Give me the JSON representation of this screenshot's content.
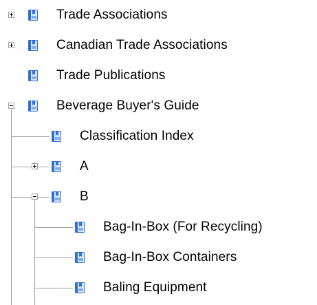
{
  "tree": {
    "nodes": [
      {
        "label": "Trade Associations",
        "level": 0,
        "state": "collapsed"
      },
      {
        "label": "Canadian Trade Associations",
        "level": 0,
        "state": "collapsed"
      },
      {
        "label": "Trade Publications",
        "level": 0,
        "state": "leaf"
      },
      {
        "label": "Beverage Buyer's Guide",
        "level": 0,
        "state": "expanded"
      },
      {
        "label": "Classification Index",
        "level": 1,
        "state": "leaf"
      },
      {
        "label": "A",
        "level": 1,
        "state": "collapsed"
      },
      {
        "label": "B",
        "level": 1,
        "state": "expanded"
      },
      {
        "label": "Bag-In-Box (For Recycling)",
        "level": 2,
        "state": "leaf"
      },
      {
        "label": "Bag-In-Box Containers",
        "level": 2,
        "state": "leaf"
      },
      {
        "label": "Baling Equipment",
        "level": 2,
        "state": "leaf"
      }
    ]
  },
  "colors": {
    "icon_blue": "#2f6fd6",
    "icon_light": "#dce9fb",
    "tree_line": "#a0a0a0",
    "text": "#000000"
  }
}
